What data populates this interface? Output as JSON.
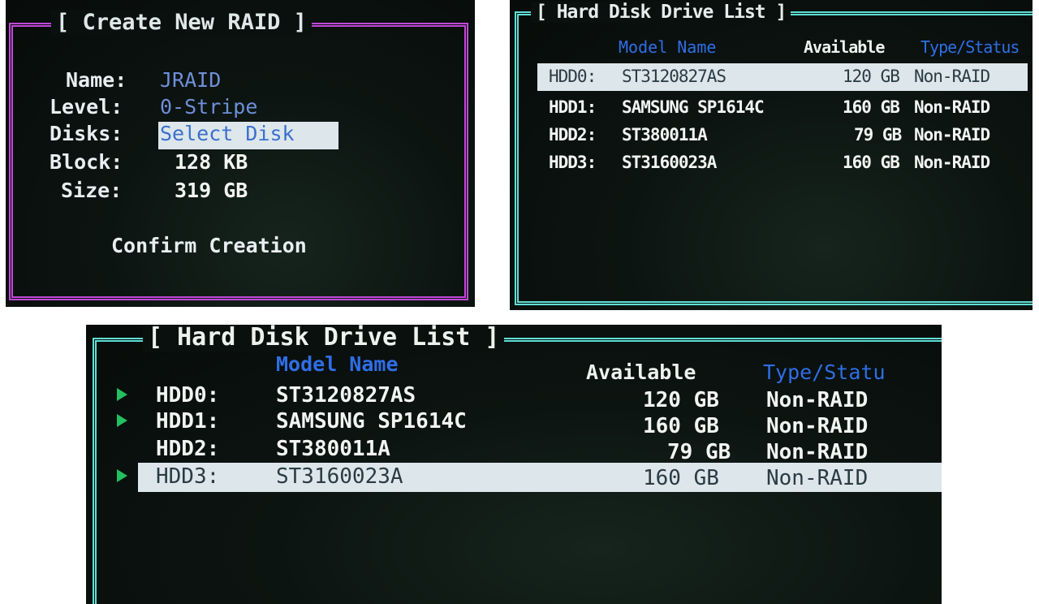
{
  "create_raid": {
    "title": "[ Create New RAID ]",
    "fields": [
      {
        "label": "Name:",
        "value": "JRAID"
      },
      {
        "label": "Level:",
        "value": "0-Stripe"
      },
      {
        "label": "Disks:",
        "value": "Select Disk"
      },
      {
        "label": "Block:",
        "value": "128 KB"
      },
      {
        "label": "Size:",
        "value": "319 GB"
      }
    ],
    "confirm_label": "Confirm Creation",
    "frame_color": "#c048d8"
  },
  "hdd_list_1": {
    "title": "[ Hard Disk Drive List ]",
    "headers": {
      "model": "Model Name",
      "available": "Available",
      "type": "Type/Status"
    },
    "rows": [
      {
        "id": "HDD0:",
        "model": "ST3120827AS",
        "available": "120 GB",
        "type": "Non-RAID"
      },
      {
        "id": "HDD1:",
        "model": "SAMSUNG SP1614C",
        "available": "160 GB",
        "type": "Non-RAID"
      },
      {
        "id": "HDD2:",
        "model": "ST380011A",
        "available": "79 GB",
        "type": "Non-RAID"
      },
      {
        "id": "HDD3:",
        "model": "ST3160023A",
        "available": "160 GB",
        "type": "Non-RAID"
      }
    ],
    "frame_color": "#5fe0d6"
  },
  "hdd_list_2": {
    "title": "[ Hard Disk Drive List ]",
    "headers": {
      "model": "Model Name",
      "available": "Available",
      "type": "Type/Statu"
    },
    "rows": [
      {
        "id": "HDD0:",
        "model": "ST3120827AS",
        "available": "120 GB",
        "type": "Non-RAID",
        "selected": true
      },
      {
        "id": "HDD1:",
        "model": "SAMSUNG SP1614C",
        "available": "160 GB",
        "type": "Non-RAID",
        "selected": true
      },
      {
        "id": "HDD2:",
        "model": "ST380011A",
        "available": "79 GB",
        "type": "Non-RAID",
        "selected": false
      },
      {
        "id": "HDD3:",
        "model": "ST3160023A",
        "available": "160 GB",
        "type": "Non-RAID",
        "selected": true
      }
    ],
    "frame_color": "#5fe0d6",
    "arrow_color": "#22c060"
  }
}
